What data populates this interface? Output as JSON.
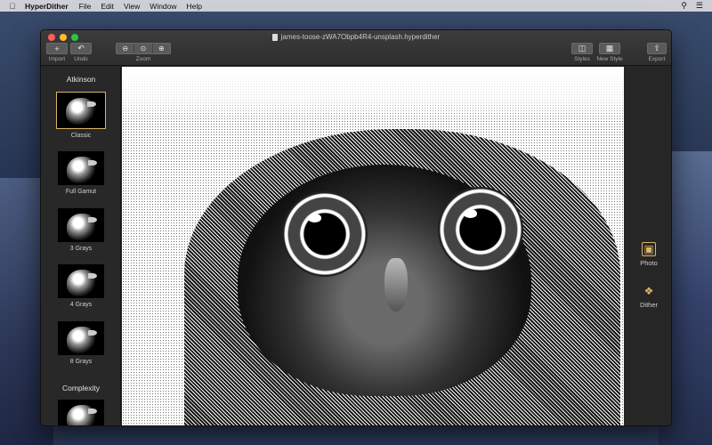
{
  "menubar": {
    "app_name": "HyperDither",
    "items": [
      "File",
      "Edit",
      "View",
      "Window",
      "Help"
    ]
  },
  "window": {
    "title": "james-toose-zWA7Obpb4R4-unsplash.hyperdither"
  },
  "toolbar": {
    "import_label": "Import",
    "undo_label": "Undo",
    "zoom_label": "Zoom",
    "styles_label": "Styles",
    "new_style_label": "New Style",
    "export_label": "Export"
  },
  "sidebar": {
    "section1_title": "Atkinson",
    "presets": [
      {
        "label": "Classic",
        "selected": true
      },
      {
        "label": "Full Gamut"
      },
      {
        "label": "3 Grays"
      },
      {
        "label": "4 Grays"
      },
      {
        "label": "8 Grays"
      }
    ],
    "section2_title": "Complexity"
  },
  "right_panel": {
    "photo_label": "Photo",
    "dither_label": "Dither"
  },
  "colors": {
    "accent": "#d9b76a",
    "window_bg": "#262626"
  },
  "icons": {
    "import": "plus-icon",
    "undo": "undo-arrow-icon",
    "zoom_out": "zoom-out-icon",
    "zoom_fit": "zoom-fit-icon",
    "zoom_in": "zoom-in-icon",
    "styles": "sidebar-icon",
    "new_style": "new-style-icon",
    "export": "share-icon",
    "photo": "photo-icon",
    "dither": "dither-icon"
  }
}
